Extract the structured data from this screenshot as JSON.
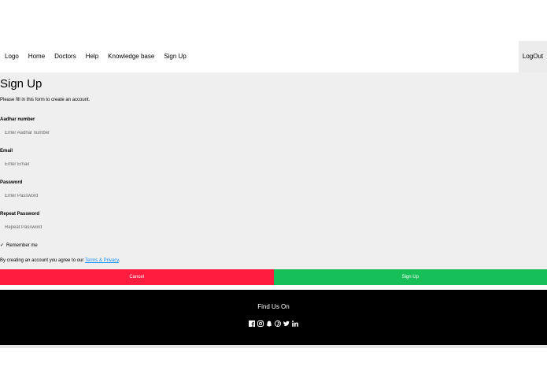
{
  "nav": {
    "links": [
      "Logo",
      "Home",
      "Doctors",
      "Help",
      "Knowledge base",
      "Sign Up"
    ],
    "logout": "LogOut"
  },
  "form": {
    "title": "Sign Up",
    "intro": "Please fill in this form to create an account.",
    "fields": [
      {
        "label": "Aadhar number",
        "placeholder": "Enter Aadhar number",
        "value": ""
      },
      {
        "label": "Email",
        "placeholder": "Enter Email",
        "value": ""
      },
      {
        "label": "Password",
        "placeholder": "Enter Password",
        "value": ""
      },
      {
        "label": "Repeat Password",
        "placeholder": "Repeat Password",
        "value": ""
      }
    ],
    "remember_label": "Remember me",
    "remember_checked": true,
    "terms_prefix": "By creating an account you agree to our ",
    "terms_link": "Terms & Privacy",
    "terms_suffix": ".",
    "cancel_label": "Cancel",
    "signup_label": "Sign Up",
    "cancel_color": "#ff1c3f",
    "signup_color": "#17bf59"
  },
  "footer": {
    "title": "Find Us On",
    "social_icons": [
      "facebook-icon",
      "instagram-icon",
      "snapchat-icon",
      "pinterest-icon",
      "twitter-icon",
      "linkedin-icon"
    ]
  }
}
